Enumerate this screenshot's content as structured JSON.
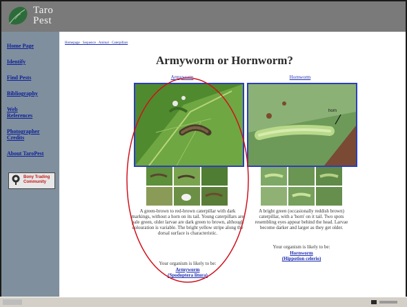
{
  "banner": {
    "logo_text": "Taro\nPest"
  },
  "sidebar": {
    "items": [
      {
        "label": "Home Page"
      },
      {
        "label": "Identify"
      },
      {
        "label": "Find Pests"
      },
      {
        "label": "Bibliography"
      },
      {
        "label": "Web\nReferences"
      },
      {
        "label": "Photographer\nCredits"
      },
      {
        "label": "About TaroPest"
      }
    ],
    "badge_text": "Bony Trading\nCommunity"
  },
  "main": {
    "breadcrumb": "Homepage · Sequence · Animal · Caterpillars",
    "title": "Armyworm or Hornworm?",
    "left": {
      "title": "Armyworm",
      "description": "A green-brown to red-brown caterpillar with dark markings, without a horn on its tail. Young caterpillars are pale green, older larvae are dark green to brown, although colouration is variable. The bright yellow stripe along the dorsal surface is characteristic.",
      "prompt": "Your organism is likely to be:",
      "result_line1": "Armyworm",
      "result_line2": "(Spodoptera litura)"
    },
    "right": {
      "title": "Hornworm",
      "horn_label": "horn",
      "description": "A bright green (occasionally reddish brown) caterpillar, with a 'horn' on it tail. Two spots resembling eyes appear behind the head. Larvae become darker and larger as they get older.",
      "prompt": "Your organism is likely to be:",
      "result_line1": "Hornworm",
      "result_line2": "(Hippotion celerio)"
    }
  },
  "colors": {
    "banner": "#7a7a7a",
    "sidebar": "#7f8f9d",
    "link": "#1a2bb0",
    "highlight_ellipse": "#d0101a"
  }
}
